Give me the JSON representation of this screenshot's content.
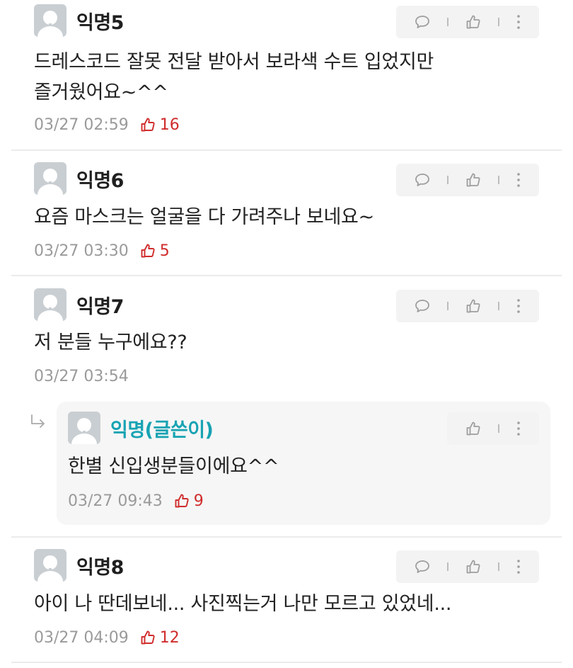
{
  "comments": [
    {
      "author": "익명5",
      "text_lines": [
        "드레스코드 잘못 전달 받아서 보라색 수트 입었지만",
        "즐거웠어요~^^"
      ],
      "time": "03/27 02:59",
      "likes": "16"
    },
    {
      "author": "익명6",
      "text_lines": [
        "요즘 마스크는 얼굴을 다 가려주나 보네요~"
      ],
      "time": "03/27 03:30",
      "likes": "5"
    },
    {
      "author": "익명7",
      "text_lines": [
        "저 분들 누구에요??"
      ],
      "time": "03/27 03:54",
      "likes": ""
    },
    {
      "author": "익명8",
      "text_lines": [
        "아이 나 딴데보네... 사진찍는거 나만 모르고 있었네..."
      ],
      "time": "03/27 04:09",
      "likes": "12"
    }
  ],
  "reply": {
    "author": "익명(글쓴이)",
    "text": "한별 신입생분들이에요^^",
    "time": "03/27 09:43",
    "likes": "9"
  },
  "icons": {
    "comment": "speech-bubble-icon",
    "like": "thumbs-up-icon",
    "more": "vertical-dots-icon",
    "reply": "reply-arrow-icon",
    "avatar": "default-profile-avatar"
  },
  "colors": {
    "author_highlight": "#17a3b3",
    "like_count": "#d02c2c",
    "meta_text": "#9a9a9a",
    "action_bg": "#f3f3f3"
  }
}
